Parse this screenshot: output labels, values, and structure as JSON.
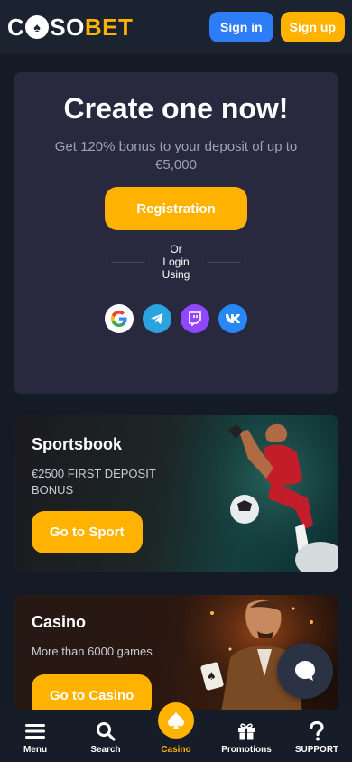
{
  "header": {
    "logo": {
      "part1": "C",
      "part2": "SO",
      "part3": "BET"
    },
    "signin_label": "Sign in",
    "signup_label": "Sign up"
  },
  "create": {
    "title": "Create one now!",
    "subtitle": "Get 120% bonus to your deposit of up to €5,000",
    "registration_label": "Registration",
    "or_text": "Or Login Using",
    "socials": [
      "google-icon",
      "telegram-icon",
      "twitch-icon",
      "vk-icon"
    ]
  },
  "sportsbook": {
    "title": "Sportsbook",
    "desc": "€2500 FIRST DEPOSIT BONUS",
    "cta": "Go to Sport"
  },
  "casino": {
    "title": "Casino",
    "desc": "More than 6000 games",
    "cta": "Go to Casino"
  },
  "nav": {
    "menu": "Menu",
    "search": "Search",
    "casino": "Casino",
    "promotions": "Promotions",
    "support": "SUPPORT"
  },
  "colors": {
    "accent": "#ffb300",
    "signin": "#2d7df6",
    "card": "#28283f",
    "background": "#141a26"
  }
}
